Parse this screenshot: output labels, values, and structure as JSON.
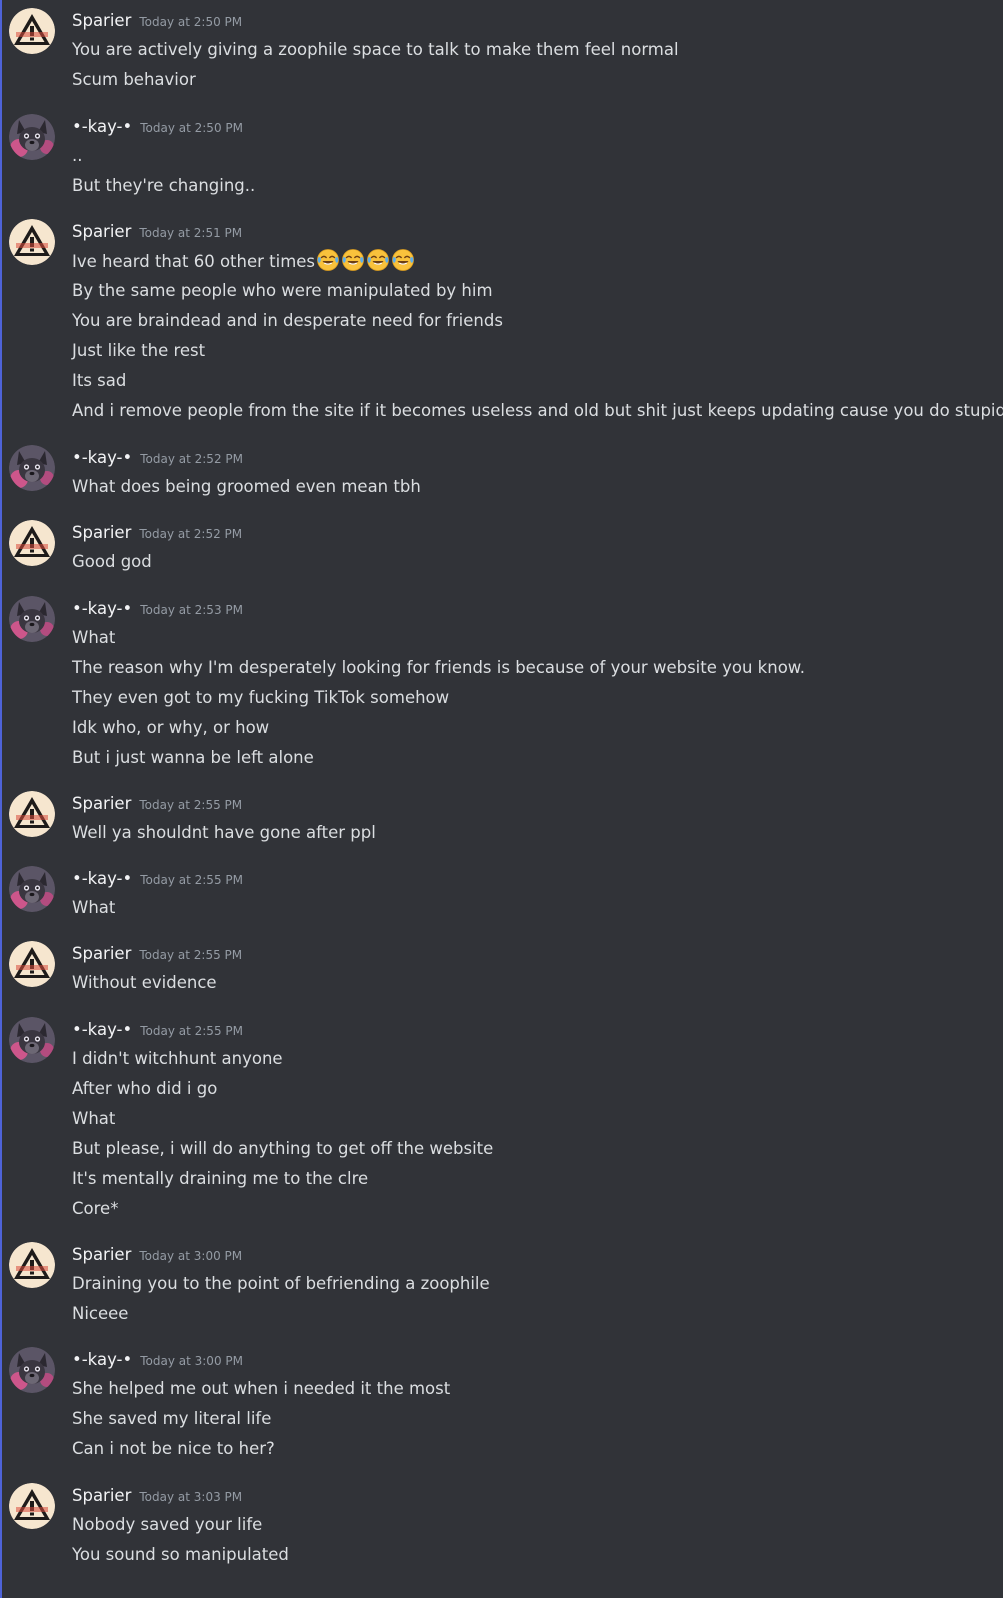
{
  "theme": {
    "background": "#313338",
    "accent_border": "#4e63d8",
    "author_color": "#f2f3f5",
    "timestamp_color": "#949ba4",
    "text_color": "#dbdee1"
  },
  "users": {
    "sparier": {
      "name": "Sparier",
      "avatar_icon": "warning-triangle-avatar-icon"
    },
    "kay": {
      "name": "•-kay-•",
      "avatar_icon": "wolf-avatar-icon"
    }
  },
  "messages": [
    {
      "author": "Sparier",
      "time": "Today at 2:50 PM",
      "lines": [
        "You are actively giving a zoophile space to talk to make them feel normal",
        "Scum behavior"
      ]
    },
    {
      "author": "•-kay-•",
      "time": "Today at 2:50 PM",
      "lines": [
        "..",
        "But they're changing.."
      ]
    },
    {
      "author": "Sparier",
      "time": "Today at 2:51 PM",
      "lines": [
        "Ive heard that 60 other times",
        "By the same people who were manipulated by him",
        "You are braindead and in desperate need for friends",
        "Just like the rest",
        "Its sad",
        "And i remove people from the site if it becomes useless and old but shit just keeps updating cause you do stupid shit"
      ],
      "emoji": {
        "line": 0,
        "name": "joy-emoji",
        "count": 4
      }
    },
    {
      "author": "•-kay-•",
      "time": "Today at 2:52 PM",
      "lines": [
        "What does being groomed even mean tbh"
      ]
    },
    {
      "author": "Sparier",
      "time": "Today at 2:52 PM",
      "lines": [
        "Good god"
      ]
    },
    {
      "author": "•-kay-•",
      "time": "Today at 2:53 PM",
      "lines": [
        "What",
        "The reason why I'm desperately looking for friends is because of your website you know.",
        "They even got to my fucking TikTok somehow",
        "Idk who, or why, or how",
        "But i just wanna be left alone"
      ]
    },
    {
      "author": "Sparier",
      "time": "Today at 2:55 PM",
      "lines": [
        "Well ya shouldnt have gone after ppl"
      ]
    },
    {
      "author": "•-kay-•",
      "time": "Today at 2:55 PM",
      "lines": [
        "What"
      ]
    },
    {
      "author": "Sparier",
      "time": "Today at 2:55 PM",
      "lines": [
        "Without evidence"
      ]
    },
    {
      "author": "•-kay-•",
      "time": "Today at 2:55 PM",
      "lines": [
        "I didn't witchhunt anyone",
        "After who did i go",
        "What",
        "But please, i will do anything to get off the website",
        "It's mentally draining me to the clre",
        "Core*"
      ]
    },
    {
      "author": "Sparier",
      "time": "Today at 3:00 PM",
      "lines": [
        "Draining you to the point of befriending a zoophile",
        "Niceee"
      ]
    },
    {
      "author": "•-kay-•",
      "time": "Today at 3:00 PM",
      "lines": [
        "She helped me out when i needed it the most",
        "She saved my literal life",
        "Can i not be nice to her?"
      ]
    },
    {
      "author": "Sparier",
      "time": "Today at 3:03 PM",
      "lines": [
        "Nobody saved your life",
        "You sound so manipulated"
      ]
    }
  ]
}
